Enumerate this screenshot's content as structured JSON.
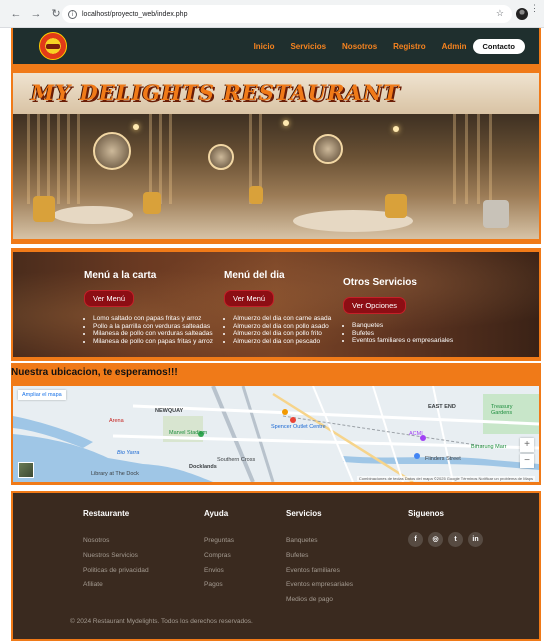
{
  "browser": {
    "url": "localhost/proyecto_web/index.php"
  },
  "nav": {
    "items": [
      "Inicio",
      "Servicios",
      "Nosotros",
      "Registro",
      "Admin"
    ],
    "contact": "Contacto"
  },
  "hero": {
    "title": "MY DELIGHTS RESTAURANT"
  },
  "menu_section": {
    "columns": [
      {
        "title": "Menú a la carta",
        "button": "Ver Menú",
        "items": [
          "Lomo saltado con papas fritas y arroz",
          "Pollo a la parrilla con verduras salteadas",
          "Milanesa de pollo con verduras salteadas",
          "Milanesa de pollo con papas fritas y arroz"
        ]
      },
      {
        "title": "Menú del dia",
        "button": "Ver Menú",
        "items": [
          "Almuerzo del dia con carne asada",
          "Almuerzo del dia con pollo asado",
          "Almuerzo del dia con pollo frito",
          "Almuerzo del dia con pescado"
        ]
      },
      {
        "title": "Otros Servicios",
        "button": "Ver Opciones",
        "items": [
          "Banquetes",
          "Bufetes",
          "Eventos familiares o empresariales"
        ]
      }
    ]
  },
  "location": {
    "title": "Nuestra ubicacion, te esperamos!!!",
    "enlarge": "Ampliar el mapa",
    "labels": [
      "NEWQUAY",
      "EAST END",
      "Marvel Stadium",
      "Southern Cross",
      "Docklands",
      "Flinders Street",
      "Arena",
      "Bio Yarra",
      "Library at The Dock",
      "ACMI",
      "Treasury Gardens",
      "Birrarung Marr",
      "Spencer Outlet Centre"
    ],
    "footer_text": "Combinaciones de teclas   Datos del mapa ©2025 Google   Términos   Notificar un problema de Maps"
  },
  "footer": {
    "columns": [
      {
        "title": "Restaurante",
        "items": [
          "Nosotros",
          "Nuestros Servicios",
          "Politicas de privacidad",
          "Afiliate"
        ]
      },
      {
        "title": "Ayuda",
        "items": [
          "Preguntas",
          "Compras",
          "Envios",
          "Pagos"
        ]
      },
      {
        "title": "Servicios",
        "items": [
          "Banquetes",
          "Bufetes",
          "Eventos familiares",
          "Eventos empresariales",
          "Medios de pago"
        ]
      }
    ],
    "social_title": "Siguenos",
    "social": [
      "f",
      "◎",
      "t",
      "in"
    ],
    "copyright": "© 2024 Restaurant Mydelights. Todos los derechos reservados."
  },
  "colors": {
    "accent": "#f07a18",
    "header_bg": "#1f2f2e",
    "footer_bg": "#3a2a1f",
    "button_red": "#8d0e14"
  }
}
